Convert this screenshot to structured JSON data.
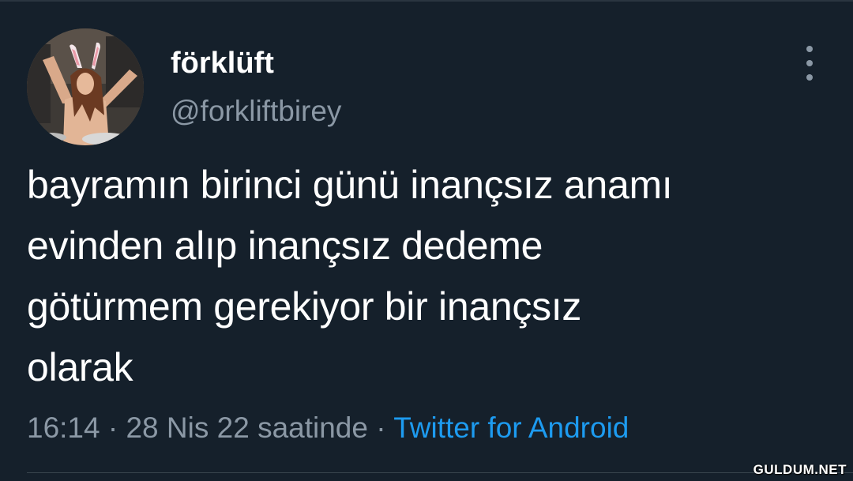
{
  "profile": {
    "display_name": "förklüft",
    "handle": "@forkliftbirey"
  },
  "tweet": {
    "text": "bayramın birinci günü inançsız anamı\nevinden alıp inançsız dedeme\ngötürmem gerekiyor bir inançsız\nolarak"
  },
  "meta": {
    "time": "16:14",
    "separator": " · ",
    "date": "28 Nis 22 saatinde",
    "separator2": " · ",
    "source": "Twitter for Android"
  },
  "watermark": {
    "text": "GULDUM.NET"
  },
  "icons": {
    "more": "more-vertical-icon"
  },
  "colors": {
    "background": "#15202b",
    "text": "#ffffff",
    "secondary": "#8b98a5",
    "accent": "#1d9bf0"
  }
}
